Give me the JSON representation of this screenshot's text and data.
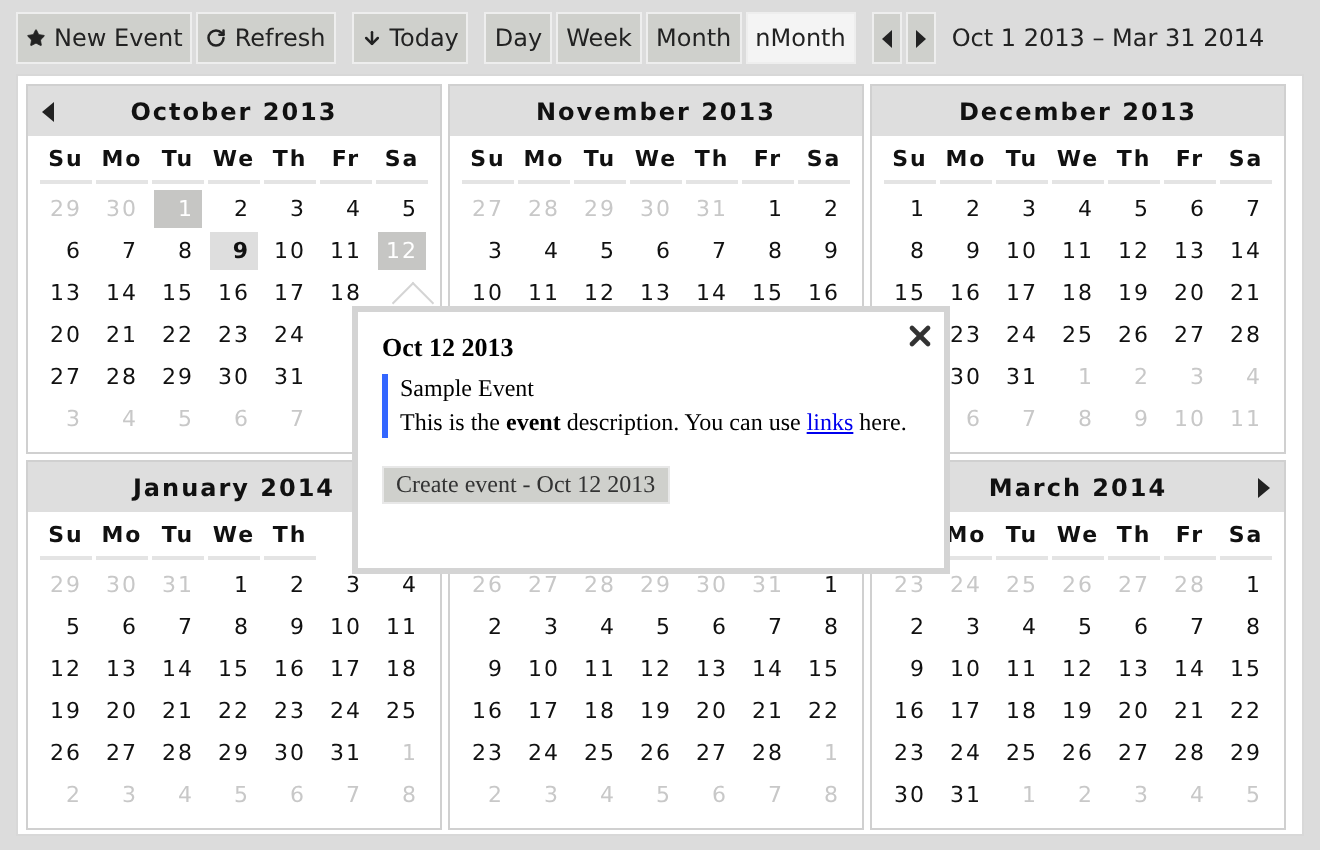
{
  "toolbar": {
    "groups": [
      {
        "buttons": [
          {
            "label": "New Event",
            "selected": false
          },
          {
            "label": "Refresh",
            "selected": false
          }
        ]
      },
      {
        "buttons": [
          {
            "label": "Today",
            "selected": false
          }
        ]
      },
      {
        "buttons": [
          {
            "label": "Day",
            "selected": false
          },
          {
            "label": "Week",
            "selected": false
          },
          {
            "label": "Month",
            "selected": false
          },
          {
            "label": "nMonth",
            "selected": true
          }
        ]
      },
      {
        "buttons": [
          {
            "selected": false
          },
          {
            "selected": false
          }
        ]
      }
    ],
    "range": "Oct 1 2013 – Mar 31 2014"
  },
  "months": [
    {
      "title": "October 2013",
      "weekdays_first_covered": false,
      "weekdays": [
        "Su",
        "Mo",
        "Tu",
        "We",
        "Th",
        "Fr",
        "Sa"
      ],
      "weeks": [
        {
          "first_covered": false,
          "days": [
            {
              "day": "29",
              "kind": "outside",
              "selected": false
            },
            {
              "day": "30",
              "kind": "outside",
              "selected": false
            },
            {
              "day": "1",
              "kind": "current",
              "selected": true
            },
            {
              "day": "2",
              "kind": "current",
              "selected": false
            },
            {
              "day": "3",
              "kind": "current",
              "selected": false
            },
            {
              "day": "4",
              "kind": "current",
              "selected": false
            },
            {
              "day": "5",
              "kind": "current",
              "selected": false
            }
          ]
        },
        {
          "first_covered": false,
          "days": [
            {
              "day": "6",
              "kind": "current",
              "selected": false
            },
            {
              "day": "7",
              "kind": "current",
              "selected": false
            },
            {
              "day": "8",
              "kind": "current",
              "selected": false
            },
            {
              "day": "9",
              "kind": "today",
              "selected": false
            },
            {
              "day": "10",
              "kind": "current",
              "selected": false
            },
            {
              "day": "11",
              "kind": "current",
              "selected": false
            },
            {
              "day": "12",
              "kind": "current",
              "selected": true
            }
          ]
        },
        {
          "first_covered": false,
          "days": [
            {
              "day": "13",
              "kind": "current",
              "selected": false
            },
            {
              "day": "14",
              "kind": "current",
              "selected": false
            },
            {
              "day": "15",
              "kind": "current",
              "selected": false
            },
            {
              "day": "16",
              "kind": "current",
              "selected": false
            },
            {
              "day": "17",
              "kind": "current",
              "selected": false
            },
            {
              "day": "18",
              "kind": "current",
              "selected": false
            }
          ]
        },
        {
          "first_covered": false,
          "days": [
            {
              "day": "20",
              "kind": "current",
              "selected": false
            },
            {
              "day": "21",
              "kind": "current",
              "selected": false
            },
            {
              "day": "22",
              "kind": "current",
              "selected": false
            },
            {
              "day": "23",
              "kind": "current",
              "selected": false
            },
            {
              "day": "24",
              "kind": "current",
              "selected": false
            }
          ]
        },
        {
          "first_covered": false,
          "days": [
            {
              "day": "27",
              "kind": "current",
              "selected": false
            },
            {
              "day": "28",
              "kind": "current",
              "selected": false
            },
            {
              "day": "29",
              "kind": "current",
              "selected": false
            },
            {
              "day": "30",
              "kind": "current",
              "selected": false
            },
            {
              "day": "31",
              "kind": "current",
              "selected": false
            }
          ]
        },
        {
          "first_covered": false,
          "days": [
            {
              "day": "3",
              "kind": "outside",
              "selected": false
            },
            {
              "day": "4",
              "kind": "outside",
              "selected": false
            },
            {
              "day": "5",
              "kind": "outside",
              "selected": false
            },
            {
              "day": "6",
              "kind": "outside",
              "selected": false
            },
            {
              "day": "7",
              "kind": "outside",
              "selected": false
            }
          ]
        }
      ]
    },
    {
      "title": "November 2013",
      "weekdays_first_covered": false,
      "weekdays": [
        "Su",
        "Mo",
        "Tu",
        "We",
        "Th",
        "Fr",
        "Sa"
      ],
      "weeks": [
        {
          "first_covered": false,
          "days": [
            {
              "day": "27",
              "kind": "outside",
              "selected": false
            },
            {
              "day": "28",
              "kind": "outside",
              "selected": false
            },
            {
              "day": "29",
              "kind": "outside",
              "selected": false
            },
            {
              "day": "30",
              "kind": "outside",
              "selected": false
            },
            {
              "day": "31",
              "kind": "outside",
              "selected": false
            },
            {
              "day": "1",
              "kind": "current",
              "selected": false
            },
            {
              "day": "2",
              "kind": "current",
              "selected": false
            }
          ]
        },
        {
          "first_covered": false,
          "days": [
            {
              "day": "3",
              "kind": "current",
              "selected": false
            },
            {
              "day": "4",
              "kind": "current",
              "selected": false
            },
            {
              "day": "5",
              "kind": "current",
              "selected": false
            },
            {
              "day": "6",
              "kind": "current",
              "selected": false
            },
            {
              "day": "7",
              "kind": "current",
              "selected": false
            },
            {
              "day": "8",
              "kind": "current",
              "selected": false
            },
            {
              "day": "9",
              "kind": "current",
              "selected": false
            }
          ]
        },
        {
          "first_covered": false,
          "days": [
            {
              "day": "10",
              "kind": "current",
              "selected": false
            },
            {
              "day": "11",
              "kind": "current",
              "selected": false
            },
            {
              "day": "12",
              "kind": "current",
              "selected": false
            },
            {
              "day": "13",
              "kind": "current",
              "selected": false
            },
            {
              "day": "14",
              "kind": "current",
              "selected": false
            },
            {
              "day": "15",
              "kind": "current",
              "selected": false
            },
            {
              "day": "16",
              "kind": "current",
              "selected": false
            }
          ]
        }
      ]
    },
    {
      "title": "December 2013",
      "weekdays_first_covered": false,
      "weekdays": [
        "Su",
        "Mo",
        "Tu",
        "We",
        "Th",
        "Fr",
        "Sa"
      ],
      "weeks": [
        {
          "first_covered": false,
          "days": [
            {
              "day": "1",
              "kind": "current",
              "selected": false
            },
            {
              "day": "2",
              "kind": "current",
              "selected": false
            },
            {
              "day": "3",
              "kind": "current",
              "selected": false
            },
            {
              "day": "4",
              "kind": "current",
              "selected": false
            },
            {
              "day": "5",
              "kind": "current",
              "selected": false
            },
            {
              "day": "6",
              "kind": "current",
              "selected": false
            },
            {
              "day": "7",
              "kind": "current",
              "selected": false
            }
          ]
        },
        {
          "first_covered": false,
          "days": [
            {
              "day": "8",
              "kind": "current",
              "selected": false
            },
            {
              "day": "9",
              "kind": "current",
              "selected": false
            },
            {
              "day": "10",
              "kind": "current",
              "selected": false
            },
            {
              "day": "11",
              "kind": "current",
              "selected": false
            },
            {
              "day": "12",
              "kind": "current",
              "selected": false
            },
            {
              "day": "13",
              "kind": "current",
              "selected": false
            },
            {
              "day": "14",
              "kind": "current",
              "selected": false
            }
          ]
        },
        {
          "first_covered": false,
          "days": [
            {
              "day": "15",
              "kind": "current",
              "selected": false
            },
            {
              "day": "16",
              "kind": "current",
              "selected": false
            },
            {
              "day": "17",
              "kind": "current",
              "selected": false
            },
            {
              "day": "18",
              "kind": "current",
              "selected": false
            },
            {
              "day": "19",
              "kind": "current",
              "selected": false
            },
            {
              "day": "20",
              "kind": "current",
              "selected": false
            },
            {
              "day": "21",
              "kind": "current",
              "selected": false
            }
          ]
        },
        {
          "first_covered": true,
          "days": [
            {
              "day": "23",
              "kind": "current",
              "selected": false
            },
            {
              "day": "24",
              "kind": "current",
              "selected": false
            },
            {
              "day": "25",
              "kind": "current",
              "selected": false
            },
            {
              "day": "26",
              "kind": "current",
              "selected": false
            },
            {
              "day": "27",
              "kind": "current",
              "selected": false
            },
            {
              "day": "28",
              "kind": "current",
              "selected": false
            }
          ]
        },
        {
          "first_covered": true,
          "days": [
            {
              "day": "30",
              "kind": "current",
              "selected": false
            },
            {
              "day": "31",
              "kind": "current",
              "selected": false
            },
            {
              "day": "1",
              "kind": "outside",
              "selected": false
            },
            {
              "day": "2",
              "kind": "outside",
              "selected": false
            },
            {
              "day": "3",
              "kind": "outside",
              "selected": false
            },
            {
              "day": "4",
              "kind": "outside",
              "selected": false
            }
          ]
        },
        {
          "first_covered": true,
          "days": [
            {
              "day": "6",
              "kind": "outside",
              "selected": false
            },
            {
              "day": "7",
              "kind": "outside",
              "selected": false
            },
            {
              "day": "8",
              "kind": "outside",
              "selected": false
            },
            {
              "day": "9",
              "kind": "outside",
              "selected": false
            },
            {
              "day": "10",
              "kind": "outside",
              "selected": false
            },
            {
              "day": "11",
              "kind": "outside",
              "selected": false
            }
          ]
        }
      ]
    },
    {
      "title": "January 2014",
      "weekdays_first_covered": false,
      "weekdays": [
        "Su",
        "Mo",
        "Tu",
        "We",
        "Th"
      ],
      "weeks": [
        {
          "first_covered": false,
          "days": [
            {
              "day": "29",
              "kind": "outside",
              "selected": false
            },
            {
              "day": "30",
              "kind": "outside",
              "selected": false
            },
            {
              "day": "31",
              "kind": "outside",
              "selected": false
            },
            {
              "day": "1",
              "kind": "current",
              "selected": false
            },
            {
              "day": "2",
              "kind": "current",
              "selected": false
            },
            {
              "day": "3",
              "kind": "current",
              "selected": false
            },
            {
              "day": "4",
              "kind": "current",
              "selected": false
            }
          ]
        },
        {
          "first_covered": false,
          "days": [
            {
              "day": "5",
              "kind": "current",
              "selected": false
            },
            {
              "day": "6",
              "kind": "current",
              "selected": false
            },
            {
              "day": "7",
              "kind": "current",
              "selected": false
            },
            {
              "day": "8",
              "kind": "current",
              "selected": false
            },
            {
              "day": "9",
              "kind": "current",
              "selected": false
            },
            {
              "day": "10",
              "kind": "current",
              "selected": false
            },
            {
              "day": "11",
              "kind": "current",
              "selected": false
            }
          ]
        },
        {
          "first_covered": false,
          "days": [
            {
              "day": "12",
              "kind": "current",
              "selected": false
            },
            {
              "day": "13",
              "kind": "current",
              "selected": false
            },
            {
              "day": "14",
              "kind": "current",
              "selected": false
            },
            {
              "day": "15",
              "kind": "current",
              "selected": false
            },
            {
              "day": "16",
              "kind": "current",
              "selected": false
            },
            {
              "day": "17",
              "kind": "current",
              "selected": false
            },
            {
              "day": "18",
              "kind": "current",
              "selected": false
            }
          ]
        },
        {
          "first_covered": false,
          "days": [
            {
              "day": "19",
              "kind": "current",
              "selected": false
            },
            {
              "day": "20",
              "kind": "current",
              "selected": false
            },
            {
              "day": "21",
              "kind": "current",
              "selected": false
            },
            {
              "day": "22",
              "kind": "current",
              "selected": false
            },
            {
              "day": "23",
              "kind": "current",
              "selected": false
            },
            {
              "day": "24",
              "kind": "current",
              "selected": false
            },
            {
              "day": "25",
              "kind": "current",
              "selected": false
            }
          ]
        },
        {
          "first_covered": false,
          "days": [
            {
              "day": "26",
              "kind": "current",
              "selected": false
            },
            {
              "day": "27",
              "kind": "current",
              "selected": false
            },
            {
              "day": "28",
              "kind": "current",
              "selected": false
            },
            {
              "day": "29",
              "kind": "current",
              "selected": false
            },
            {
              "day": "30",
              "kind": "current",
              "selected": false
            },
            {
              "day": "31",
              "kind": "current",
              "selected": false
            },
            {
              "day": "1",
              "kind": "outside",
              "selected": false
            }
          ]
        },
        {
          "first_covered": false,
          "days": [
            {
              "day": "2",
              "kind": "outside",
              "selected": false
            },
            {
              "day": "3",
              "kind": "outside",
              "selected": false
            },
            {
              "day": "4",
              "kind": "outside",
              "selected": false
            },
            {
              "day": "5",
              "kind": "outside",
              "selected": false
            },
            {
              "day": "6",
              "kind": "outside",
              "selected": false
            },
            {
              "day": "7",
              "kind": "outside",
              "selected": false
            },
            {
              "day": "8",
              "kind": "outside",
              "selected": false
            }
          ]
        }
      ]
    },
    {
      "weeks": [
        {
          "first_covered": false,
          "days": [
            {
              "day": "26",
              "kind": "outside",
              "selected": false
            },
            {
              "day": "27",
              "kind": "outside",
              "selected": false
            },
            {
              "day": "28",
              "kind": "outside",
              "selected": false
            },
            {
              "day": "29",
              "kind": "outside",
              "selected": false
            },
            {
              "day": "30",
              "kind": "outside",
              "selected": false
            },
            {
              "day": "31",
              "kind": "outside",
              "selected": false
            },
            {
              "day": "1",
              "kind": "current",
              "selected": false
            }
          ]
        },
        {
          "first_covered": false,
          "days": [
            {
              "day": "2",
              "kind": "current",
              "selected": false
            },
            {
              "day": "3",
              "kind": "current",
              "selected": false
            },
            {
              "day": "4",
              "kind": "current",
              "selected": false
            },
            {
              "day": "5",
              "kind": "current",
              "selected": false
            },
            {
              "day": "6",
              "kind": "current",
              "selected": false
            },
            {
              "day": "7",
              "kind": "current",
              "selected": false
            },
            {
              "day": "8",
              "kind": "current",
              "selected": false
            }
          ]
        },
        {
          "first_covered": false,
          "days": [
            {
              "day": "9",
              "kind": "current",
              "selected": false
            },
            {
              "day": "10",
              "kind": "current",
              "selected": false
            },
            {
              "day": "11",
              "kind": "current",
              "selected": false
            },
            {
              "day": "12",
              "kind": "current",
              "selected": false
            },
            {
              "day": "13",
              "kind": "current",
              "selected": false
            },
            {
              "day": "14",
              "kind": "current",
              "selected": false
            },
            {
              "day": "15",
              "kind": "current",
              "selected": false
            }
          ]
        },
        {
          "first_covered": false,
          "days": [
            {
              "day": "16",
              "kind": "current",
              "selected": false
            },
            {
              "day": "17",
              "kind": "current",
              "selected": false
            },
            {
              "day": "18",
              "kind": "current",
              "selected": false
            },
            {
              "day": "19",
              "kind": "current",
              "selected": false
            },
            {
              "day": "20",
              "kind": "current",
              "selected": false
            },
            {
              "day": "21",
              "kind": "current",
              "selected": false
            },
            {
              "day": "22",
              "kind": "current",
              "selected": false
            }
          ]
        },
        {
          "first_covered": false,
          "days": [
            {
              "day": "23",
              "kind": "current",
              "selected": false
            },
            {
              "day": "24",
              "kind": "current",
              "selected": false
            },
            {
              "day": "25",
              "kind": "current",
              "selected": false
            },
            {
              "day": "26",
              "kind": "current",
              "selected": false
            },
            {
              "day": "27",
              "kind": "current",
              "selected": false
            },
            {
              "day": "28",
              "kind": "current",
              "selected": false
            },
            {
              "day": "1",
              "kind": "outside",
              "selected": false
            }
          ]
        },
        {
          "first_covered": false,
          "days": [
            {
              "day": "2",
              "kind": "outside",
              "selected": false
            },
            {
              "day": "3",
              "kind": "outside",
              "selected": false
            },
            {
              "day": "4",
              "kind": "outside",
              "selected": false
            },
            {
              "day": "5",
              "kind": "outside",
              "selected": false
            },
            {
              "day": "6",
              "kind": "outside",
              "selected": false
            },
            {
              "day": "7",
              "kind": "outside",
              "selected": false
            },
            {
              "day": "8",
              "kind": "outside",
              "selected": false
            }
          ]
        }
      ]
    },
    {
      "title": "March 2014",
      "weekdays_first_covered": true,
      "weekdays": [
        "Mo",
        "Tu",
        "We",
        "Th",
        "Fr",
        "Sa"
      ],
      "weeks": [
        {
          "first_covered": false,
          "days": [
            {
              "day": "23",
              "kind": "outside",
              "selected": false
            },
            {
              "day": "24",
              "kind": "outside",
              "selected": false
            },
            {
              "day": "25",
              "kind": "outside",
              "selected": false
            },
            {
              "day": "26",
              "kind": "outside",
              "selected": false
            },
            {
              "day": "27",
              "kind": "outside",
              "selected": false
            },
            {
              "day": "28",
              "kind": "outside",
              "selected": false
            },
            {
              "day": "1",
              "kind": "current",
              "selected": false
            }
          ]
        },
        {
          "first_covered": false,
          "days": [
            {
              "day": "2",
              "kind": "current",
              "selected": false
            },
            {
              "day": "3",
              "kind": "current",
              "selected": false
            },
            {
              "day": "4",
              "kind": "current",
              "selected": false
            },
            {
              "day": "5",
              "kind": "current",
              "selected": false
            },
            {
              "day": "6",
              "kind": "current",
              "selected": false
            },
            {
              "day": "7",
              "kind": "current",
              "selected": false
            },
            {
              "day": "8",
              "kind": "current",
              "selected": false
            }
          ]
        },
        {
          "first_covered": false,
          "days": [
            {
              "day": "9",
              "kind": "current",
              "selected": false
            },
            {
              "day": "10",
              "kind": "current",
              "selected": false
            },
            {
              "day": "11",
              "kind": "current",
              "selected": false
            },
            {
              "day": "12",
              "kind": "current",
              "selected": false
            },
            {
              "day": "13",
              "kind": "current",
              "selected": false
            },
            {
              "day": "14",
              "kind": "current",
              "selected": false
            },
            {
              "day": "15",
              "kind": "current",
              "selected": false
            }
          ]
        },
        {
          "first_covered": false,
          "days": [
            {
              "day": "16",
              "kind": "current",
              "selected": false
            },
            {
              "day": "17",
              "kind": "current",
              "selected": false
            },
            {
              "day": "18",
              "kind": "current",
              "selected": false
            },
            {
              "day": "19",
              "kind": "current",
              "selected": false
            },
            {
              "day": "20",
              "kind": "current",
              "selected": false
            },
            {
              "day": "21",
              "kind": "current",
              "selected": false
            },
            {
              "day": "22",
              "kind": "current",
              "selected": false
            }
          ]
        },
        {
          "first_covered": false,
          "days": [
            {
              "day": "23",
              "kind": "current",
              "selected": false
            },
            {
              "day": "24",
              "kind": "current",
              "selected": false
            },
            {
              "day": "25",
              "kind": "current",
              "selected": false
            },
            {
              "day": "26",
              "kind": "current",
              "selected": false
            },
            {
              "day": "27",
              "kind": "current",
              "selected": false
            },
            {
              "day": "28",
              "kind": "current",
              "selected": false
            },
            {
              "day": "29",
              "kind": "current",
              "selected": false
            }
          ]
        },
        {
          "first_covered": false,
          "days": [
            {
              "day": "30",
              "kind": "current",
              "selected": false
            },
            {
              "day": "31",
              "kind": "current",
              "selected": false
            },
            {
              "day": "1",
              "kind": "outside",
              "selected": false
            },
            {
              "day": "2",
              "kind": "outside",
              "selected": false
            },
            {
              "day": "3",
              "kind": "outside",
              "selected": false
            },
            {
              "day": "4",
              "kind": "outside",
              "selected": false
            },
            {
              "day": "5",
              "kind": "outside",
              "selected": false
            }
          ]
        }
      ]
    }
  ],
  "popup": {
    "date": "Oct 12 2013",
    "event": {
      "title": "Sample Event",
      "description": "This is the **event** description. You can use ",
      "link": "links",
      "description_end": " here.",
      "color": "#3366ff"
    },
    "create_button": "Create event - Oct 12 2013"
  }
}
